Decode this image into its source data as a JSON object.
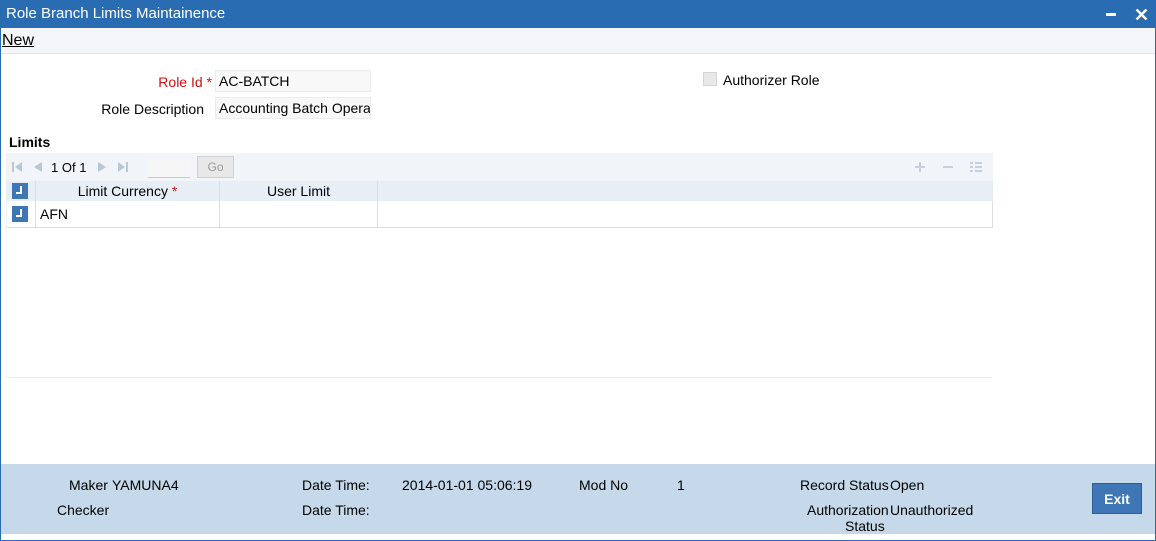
{
  "window": {
    "title": "Role Branch Limits Maintainence",
    "minimize_symbol": "▬",
    "close_symbol": "✕"
  },
  "toolbar": {
    "new_label": "New"
  },
  "form": {
    "role_id_label": "Role Id",
    "role_id_required": "*",
    "role_id_value": "AC-BATCH",
    "role_description_label": "Role Description",
    "role_description_value": "Accounting Batch Operati",
    "authorizer_role_label": "Authorizer Role",
    "authorizer_role_checked": false
  },
  "limits": {
    "section_title": "Limits",
    "pagination": {
      "current": "1",
      "of_label": "Of",
      "total": "1",
      "go_label": "Go"
    },
    "columns": {
      "limit_currency": "Limit Currency",
      "limit_currency_required": "*",
      "user_limit": "User Limit"
    },
    "rows": [
      {
        "limit_currency": "AFN",
        "user_limit": ""
      }
    ]
  },
  "footer": {
    "maker_label": "Maker",
    "maker_value": "YAMUNA4",
    "checker_label": "Checker",
    "checker_value": "",
    "date_time_label": "Date Time:",
    "maker_date_time": "2014-01-01 05:06:19",
    "checker_date_time": "",
    "mod_no_label": "Mod No",
    "mod_no_value": "1",
    "record_status_label": "Record Status",
    "record_status_value": "Open",
    "authorization_label_1": "Authorization",
    "authorization_label_2": "Status",
    "authorization_value": "Unauthorized",
    "exit_label": "Exit"
  },
  "icons": {
    "first_page": "first-page-icon",
    "prev_page": "prev-page-icon",
    "next_page": "next-page-icon",
    "last_page": "last-page-icon",
    "add_row": "add-row-icon",
    "delete_row": "delete-row-icon",
    "single_view": "single-view-icon"
  },
  "colors": {
    "titlebar": "#2a6cb2",
    "footer": "#c5d9ea",
    "accent": "#3f76b5",
    "required": "#d01010"
  }
}
